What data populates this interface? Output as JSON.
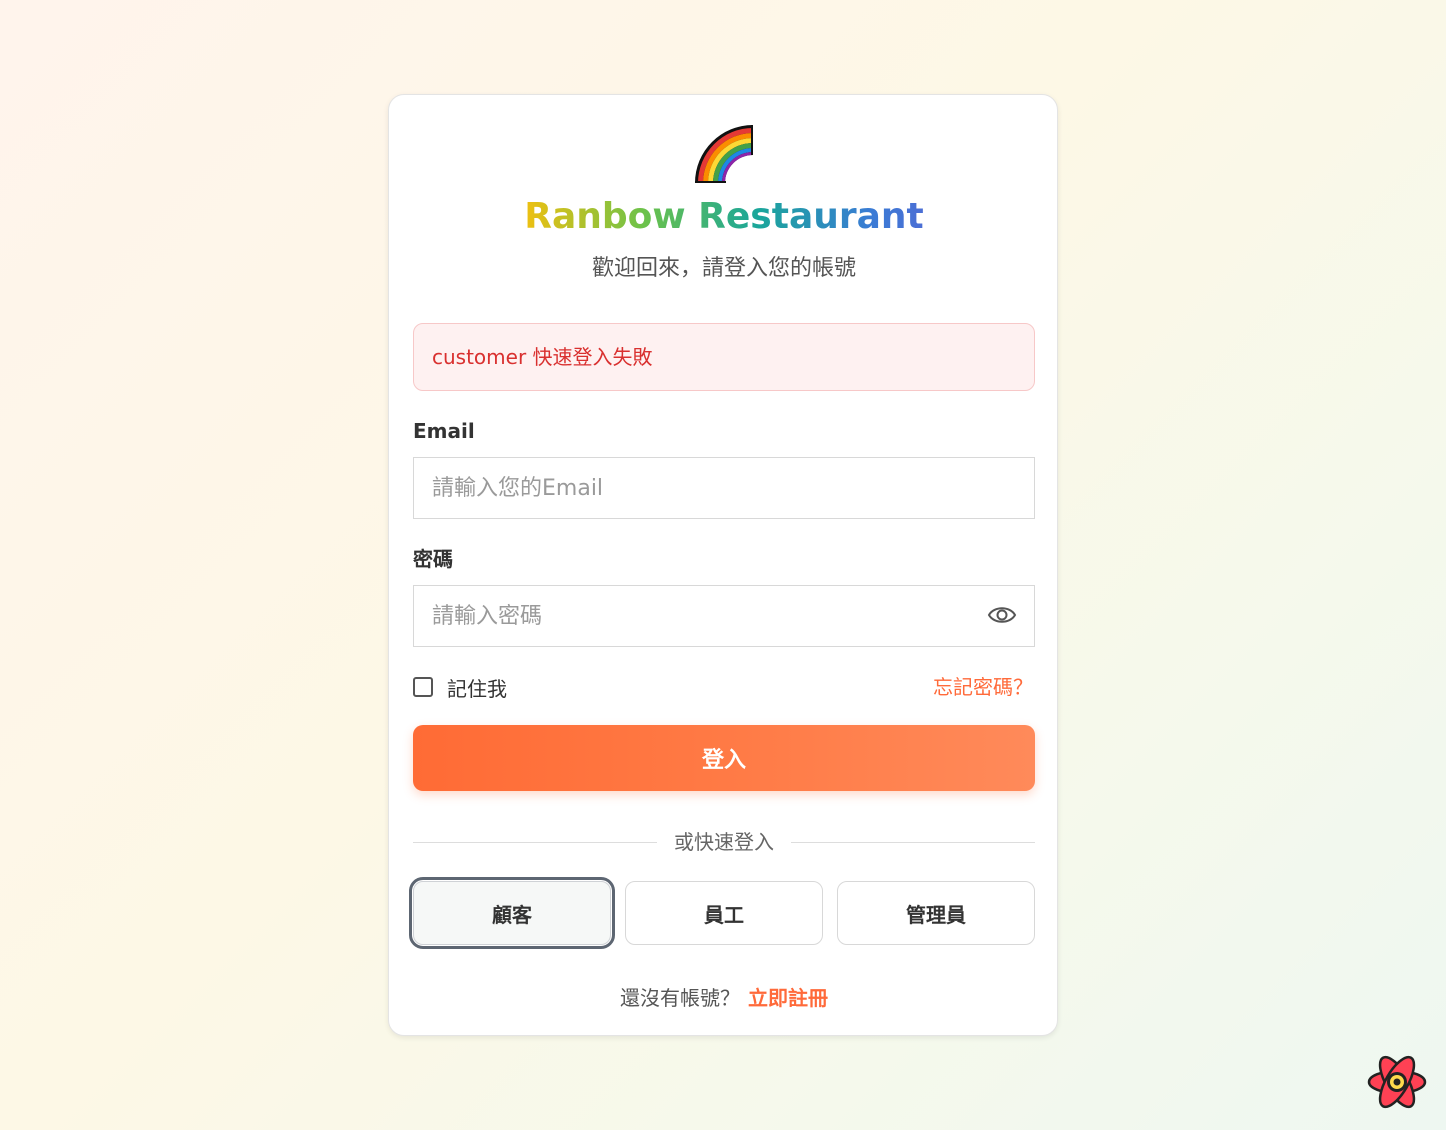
{
  "brand": {
    "logo_icon": "rainbow-icon",
    "name_part1": "Ranbow",
    "name_part2": "Restaurant",
    "subtitle": "歡迎回來，請登入您的帳號"
  },
  "alert": {
    "message": "customer 快速登入失敗",
    "color": "#d9302f"
  },
  "form": {
    "email_label": "Email",
    "email_placeholder": "請輸入您的Email",
    "email_value": "",
    "password_label": "密碼",
    "password_placeholder": "請輸入密碼",
    "password_value": "",
    "password_toggle_icon": "eye-icon",
    "remember_label": "記住我",
    "remember_checked": false,
    "forgot_label": "忘記密碼？",
    "submit_label": "登入"
  },
  "quick_login": {
    "divider_text": "或快速登入",
    "options": [
      {
        "label": "顧客",
        "focused": true
      },
      {
        "label": "員工",
        "focused": false
      },
      {
        "label": "管理員",
        "focused": false
      }
    ]
  },
  "signup": {
    "prompt": "還沒有帳號？",
    "link_label": "立即註冊"
  },
  "colors": {
    "accent": "#ff6b35",
    "alert_bg": "#fef1f1"
  },
  "devtools": {
    "icon": "react-query-devtools-icon"
  }
}
